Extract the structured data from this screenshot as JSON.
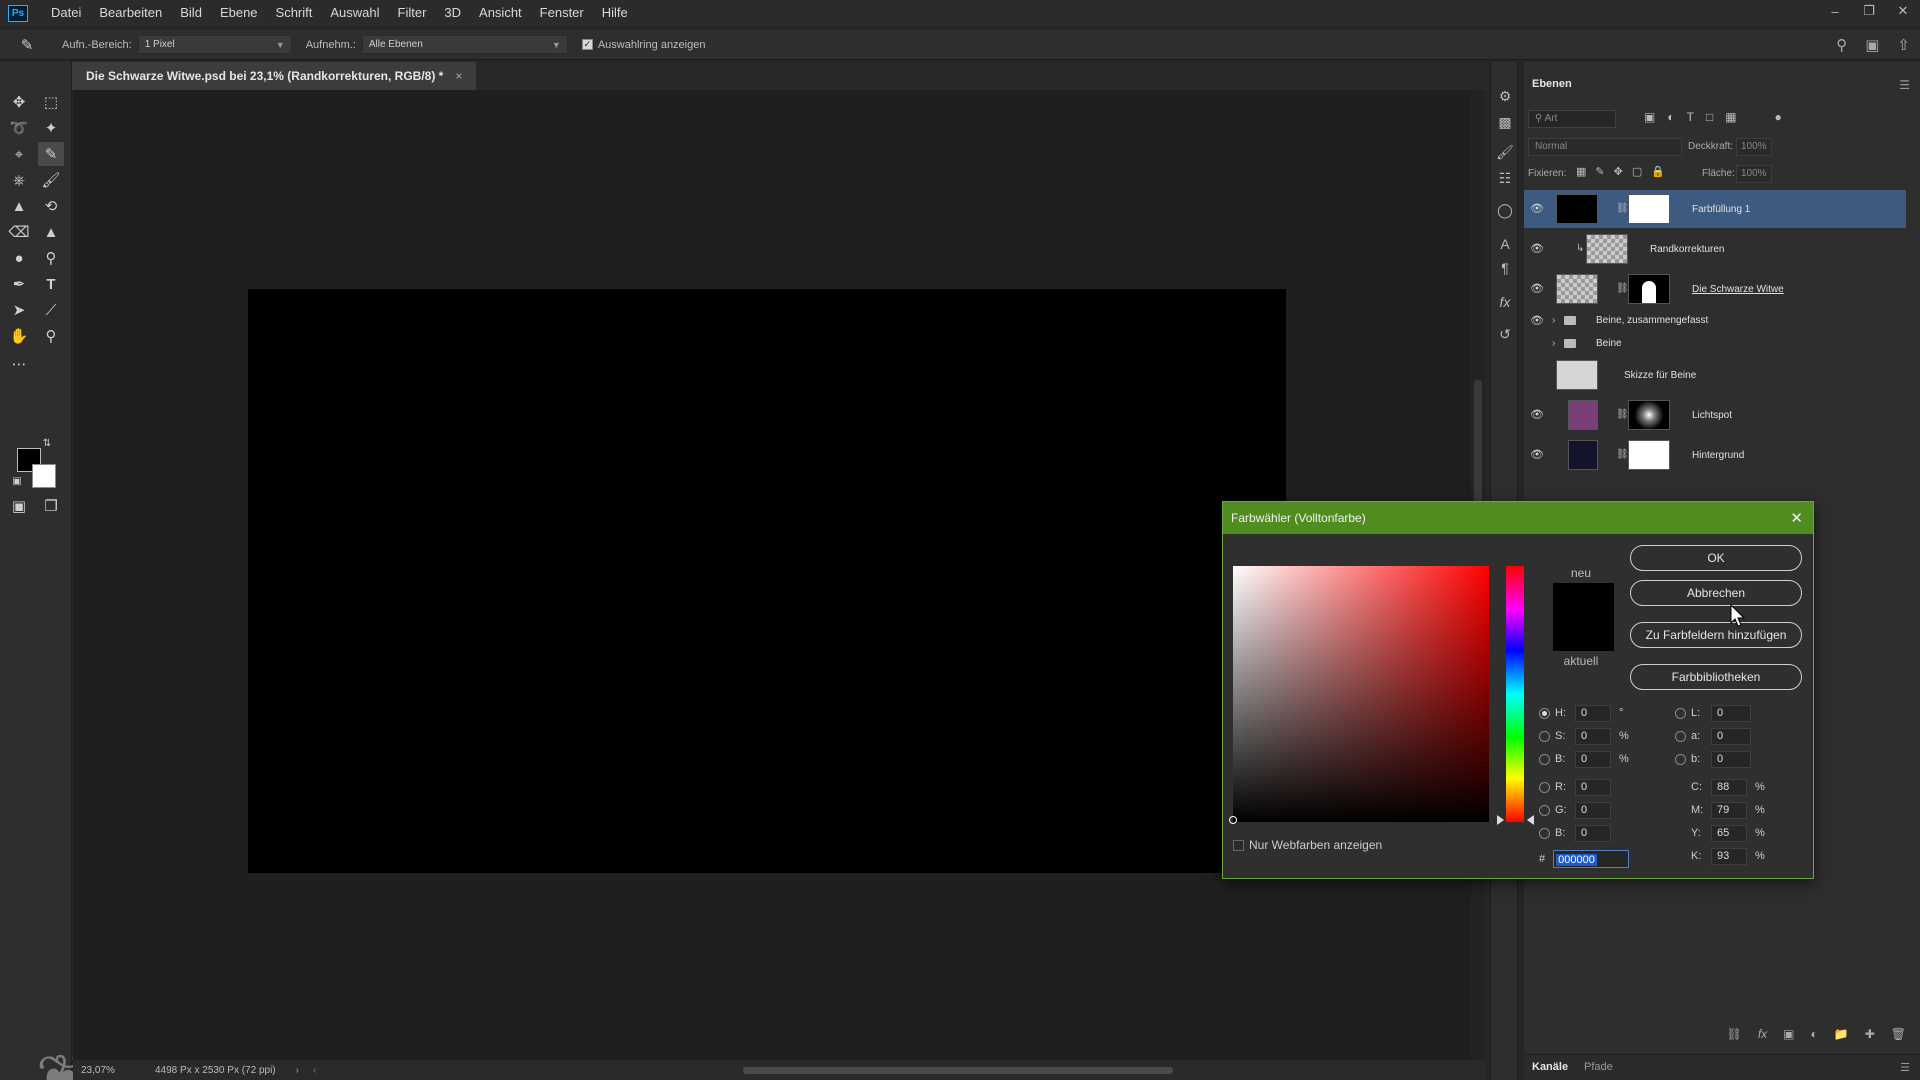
{
  "menubar": {
    "logo": "Ps",
    "items": [
      "Datei",
      "Bearbeiten",
      "Bild",
      "Ebene",
      "Schrift",
      "Auswahl",
      "Filter",
      "3D",
      "Ansicht",
      "Fenster",
      "Hilfe"
    ]
  },
  "options": {
    "sample_label": "Aufn.-Bereich:",
    "sample_value": "1 Pixel",
    "sample2_label": "Aufnehm.:",
    "sample2_value": "Alle Ebenen",
    "ring_label": "Auswahlring anzeigen"
  },
  "document": {
    "tab_title": "Die Schwarze Witwe.psd bei 23,1% (Randkorrekturen, RGB/8) *"
  },
  "status": {
    "zoom": "23,07%",
    "size": "4498 Px x 2530 Px (72 ppi)"
  },
  "layers_panel": {
    "title": "Ebenen",
    "filter_placeholder": "Art",
    "blend_mode": "Normal",
    "opacity_label": "Deckkraft:",
    "opacity_value": "100%",
    "lock_label": "Fixieren:",
    "fill_label": "Fläche:",
    "fill_value": "100%",
    "layers": [
      {
        "name": "Farbfüllung 1",
        "visible": true,
        "selected": true
      },
      {
        "name": "Randkorrekturen",
        "visible": true
      },
      {
        "name": "Die Schwarze Witwe",
        "visible": true
      },
      {
        "name": "Beine, zusammengefasst",
        "visible": true,
        "group": true
      },
      {
        "name": "Beine",
        "visible": false,
        "group": true
      },
      {
        "name": "Skizze für Beine",
        "visible": false
      },
      {
        "name": "Lichtspot",
        "visible": true
      },
      {
        "name": "Hintergrund",
        "visible": true
      }
    ],
    "bottom_tabs": [
      "Kanäle",
      "Pfade"
    ]
  },
  "color_picker": {
    "title": "Farbwähler (Volltonfarbe)",
    "new_label": "neu",
    "current_label": "aktuell",
    "buttons": {
      "ok": "OK",
      "cancel": "Abbrechen",
      "add_swatch": "Zu Farbfeldern hinzufügen",
      "libraries": "Farbbibliotheken"
    },
    "fields": {
      "H": "0",
      "S": "0",
      "B": "0",
      "R": "0",
      "G": "0",
      "Bl": "0",
      "L": "0",
      "a": "0",
      "b": "0",
      "C": "88",
      "M": "79",
      "Y": "65",
      "K": "93"
    },
    "labels": {
      "H": "H:",
      "S": "S:",
      "B": "B:",
      "R": "R:",
      "G": "G:",
      "Bl": "B:",
      "L": "L:",
      "a": "a:",
      "b": "b:",
      "C": "C:",
      "M": "M:",
      "Y": "Y:",
      "K": "K:",
      "deg": "°",
      "pct": "%",
      "hash": "#"
    },
    "hex": "000000",
    "web_only_label": "Nur Webfarben anzeigen",
    "color_new": "#000000",
    "color_current": "#000000",
    "title_bar_color": "#4e8d1e"
  }
}
